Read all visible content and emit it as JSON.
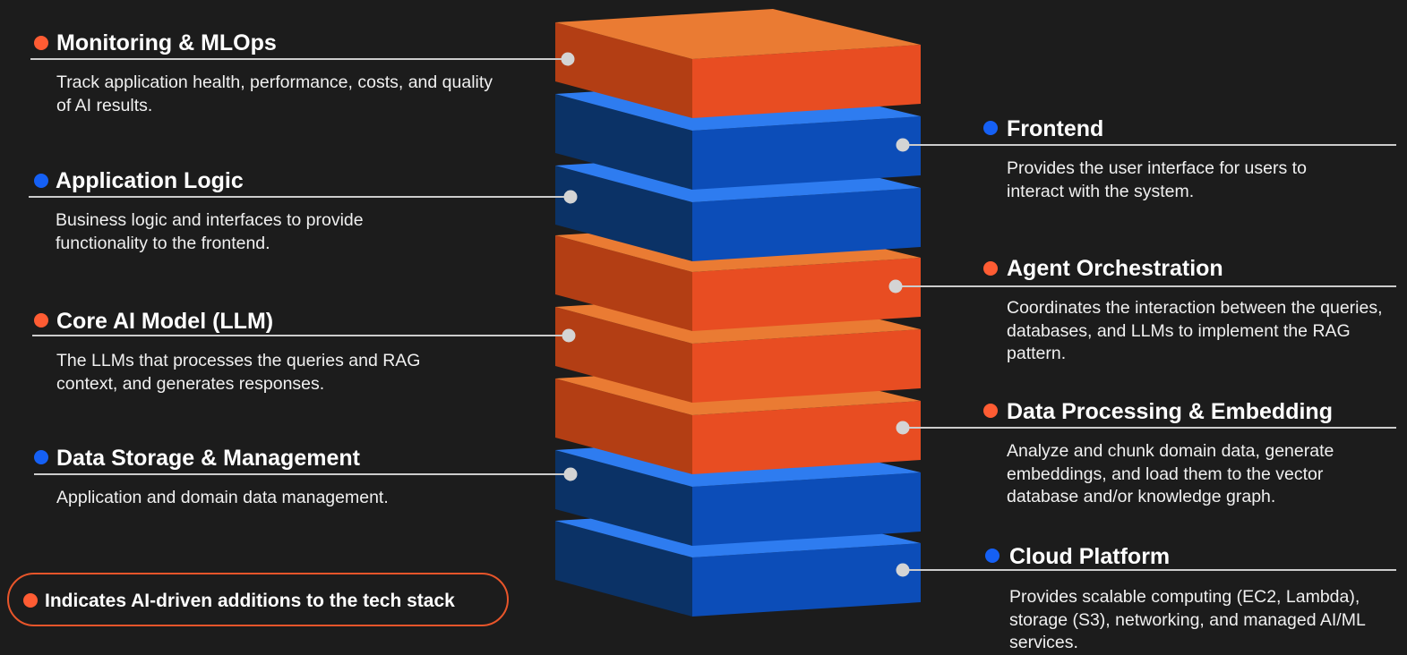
{
  "colors": {
    "background": "#1c1c1c",
    "ai_dot": "#ff5c33",
    "base_dot": "#1560f5",
    "orange_top": "#ea7b33",
    "orange_left": "#b33e14",
    "orange_front": "#e84d22",
    "blue_top": "#2e7cf0",
    "blue_left": "#0b3266",
    "blue_front": "#0c4db8",
    "connector": "#cccccc"
  },
  "stack_layers": [
    {
      "name": "monitoring-mlops",
      "color": "orange"
    },
    {
      "name": "frontend",
      "color": "blue"
    },
    {
      "name": "application-logic",
      "color": "blue"
    },
    {
      "name": "agent-orchestration",
      "color": "orange"
    },
    {
      "name": "core-ai-model",
      "color": "orange"
    },
    {
      "name": "data-processing-embedding",
      "color": "orange"
    },
    {
      "name": "data-storage-management",
      "color": "blue"
    },
    {
      "name": "cloud-platform",
      "color": "blue"
    }
  ],
  "left_labels": [
    {
      "title": "Monitoring & MLOps",
      "desc": "Track application health, performance, costs, and quality of AI results.",
      "ai": true
    },
    {
      "title": "Application Logic",
      "desc": "Business logic and interfaces to provide functionality to the frontend.",
      "ai": false
    },
    {
      "title": "Core AI Model (LLM)",
      "desc": "The LLMs that processes the queries and RAG context, and generates responses.",
      "ai": true
    },
    {
      "title": "Data Storage & Management",
      "desc": "Application and domain data management.",
      "ai": false
    }
  ],
  "right_labels": [
    {
      "title": "Frontend",
      "desc": "Provides the user interface for users to interact with the system.",
      "ai": false
    },
    {
      "title": "Agent Orchestration",
      "desc": "Coordinates the interaction between the queries, databases, and LLMs to implement the RAG pattern.",
      "ai": true
    },
    {
      "title": "Data Processing & Embedding",
      "desc": "Analyze and chunk domain data, generate embeddings, and load them to the vector database and/or knowledge graph.",
      "ai": true
    },
    {
      "title": "Cloud Platform",
      "desc": "Provides scalable computing (EC2, Lambda), storage (S3), networking, and managed AI/ML services.",
      "ai": false
    }
  ],
  "legend": {
    "text": "Indicates AI-driven additions to the tech stack",
    "ai": true
  }
}
